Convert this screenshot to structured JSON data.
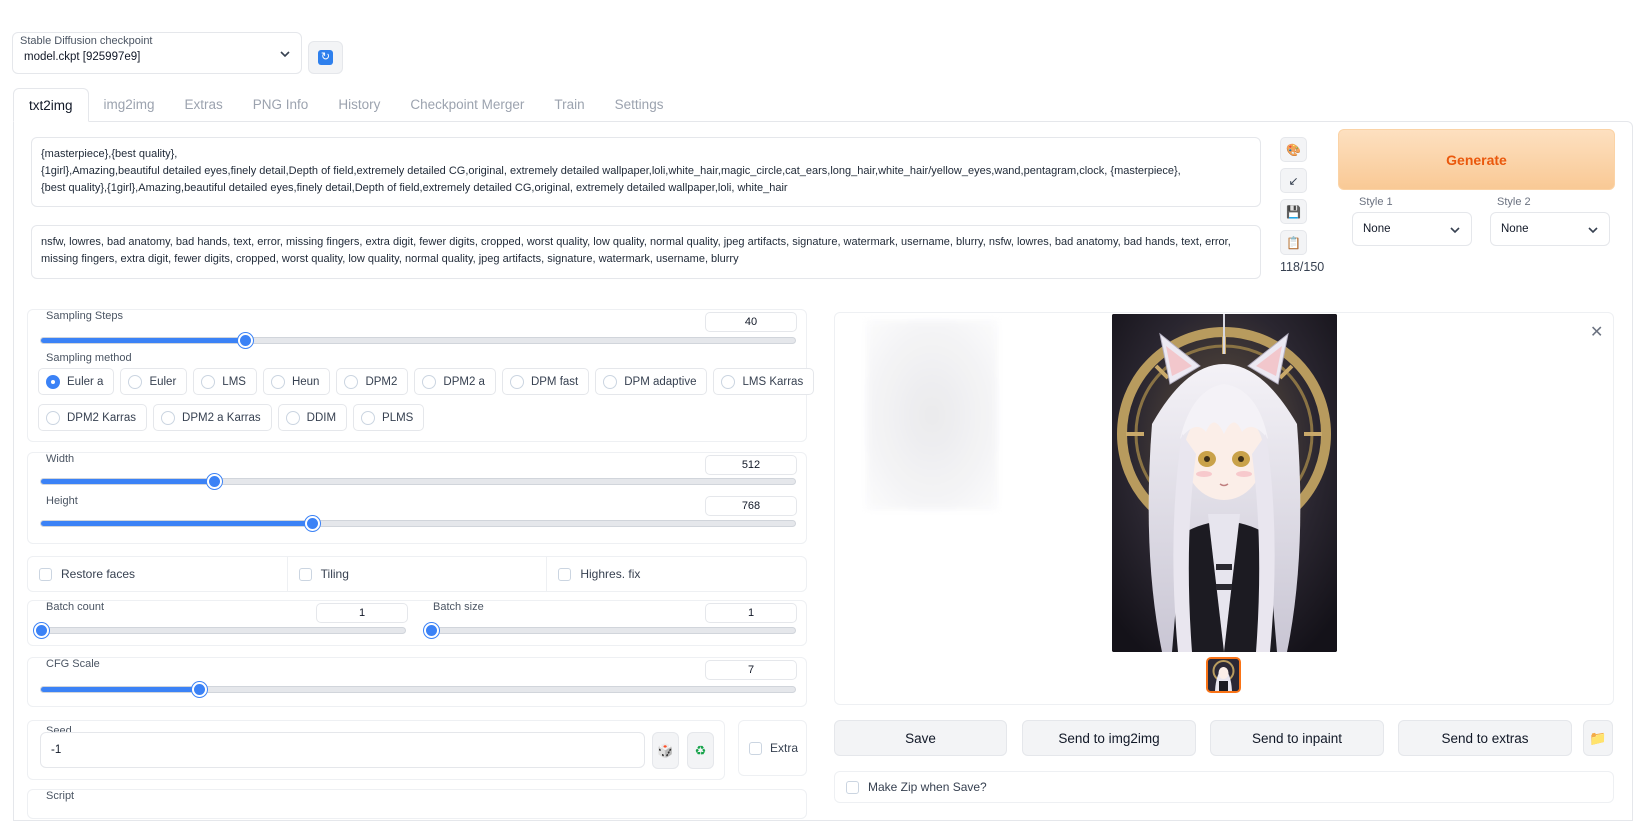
{
  "checkpoint": {
    "label": "Stable Diffusion checkpoint",
    "value": "model.ckpt [925997e9]"
  },
  "tabs": [
    {
      "label": "txt2img",
      "active": true
    },
    {
      "label": "img2img"
    },
    {
      "label": "Extras"
    },
    {
      "label": "PNG Info"
    },
    {
      "label": "History"
    },
    {
      "label": "Checkpoint Merger"
    },
    {
      "label": "Train"
    },
    {
      "label": "Settings"
    }
  ],
  "prompt": {
    "positive": "{masterpiece},{best quality},\n{1girl},Amazing,beautiful detailed eyes,finely detail,Depth of field,extremely detailed CG,original, extremely detailed wallpaper,loli,white_hair,magic_circle,cat_ears,long_hair,white_hair/yellow_eyes,wand,pentagram,clock, {masterpiece},\n{best quality},{1girl},Amazing,beautiful detailed eyes,finely detail,Depth of field,extremely detailed CG,original, extremely detailed wallpaper,loli, white_hair",
    "negative": "nsfw, lowres, bad anatomy, bad hands, text, error, missing fingers, extra digit, fewer digits, cropped, worst quality, low quality, normal quality, jpeg artifacts, signature, watermark, username, blurry, nsfw, lowres, bad anatomy, bad hands, text, error, missing fingers, extra digit, fewer digits, cropped, worst quality, low quality, normal quality, jpeg artifacts, signature, watermark, username, blurry",
    "token_count": "118/150"
  },
  "side_icons": [
    "palette-icon",
    "arrow-down-left-icon",
    "save-icon",
    "clipboard-icon"
  ],
  "generate_label": "Generate",
  "styles": {
    "style1": {
      "label": "Style 1",
      "value": "None"
    },
    "style2": {
      "label": "Style 2",
      "value": "None"
    }
  },
  "sampling_steps": {
    "label": "Sampling Steps",
    "value": "40",
    "fraction": 0.27
  },
  "sampling_method": {
    "label": "Sampling method",
    "options": [
      "Euler a",
      "Euler",
      "LMS",
      "Heun",
      "DPM2",
      "DPM2 a",
      "DPM fast",
      "DPM adaptive",
      "LMS Karras",
      "DPM2 Karras",
      "DPM2 a Karras",
      "DDIM",
      "PLMS"
    ],
    "selected": "Euler a"
  },
  "width": {
    "label": "Width",
    "value": "512",
    "fraction": 0.23
  },
  "height": {
    "label": "Height",
    "value": "768",
    "fraction": 0.36
  },
  "checkboxes": {
    "restore_faces": "Restore faces",
    "tiling": "Tiling",
    "highres_fix": "Highres. fix"
  },
  "batch_count": {
    "label": "Batch count",
    "value": "1",
    "fraction": 0.0
  },
  "batch_size": {
    "label": "Batch size",
    "value": "1",
    "fraction": 0.0
  },
  "cfg_scale": {
    "label": "CFG Scale",
    "value": "7",
    "fraction": 0.21
  },
  "seed": {
    "label": "Seed",
    "value": "-1",
    "extra_label": "Extra"
  },
  "script_label": "Script",
  "output": {
    "buttons": [
      "Save",
      "Send to img2img",
      "Send to inpaint",
      "Send to extras"
    ],
    "make_zip_label": "Make Zip when Save?"
  },
  "colors": {
    "accent": "#3b82f6",
    "generate_text": "#ea580c",
    "generate_bg": "#fbd0a0"
  }
}
